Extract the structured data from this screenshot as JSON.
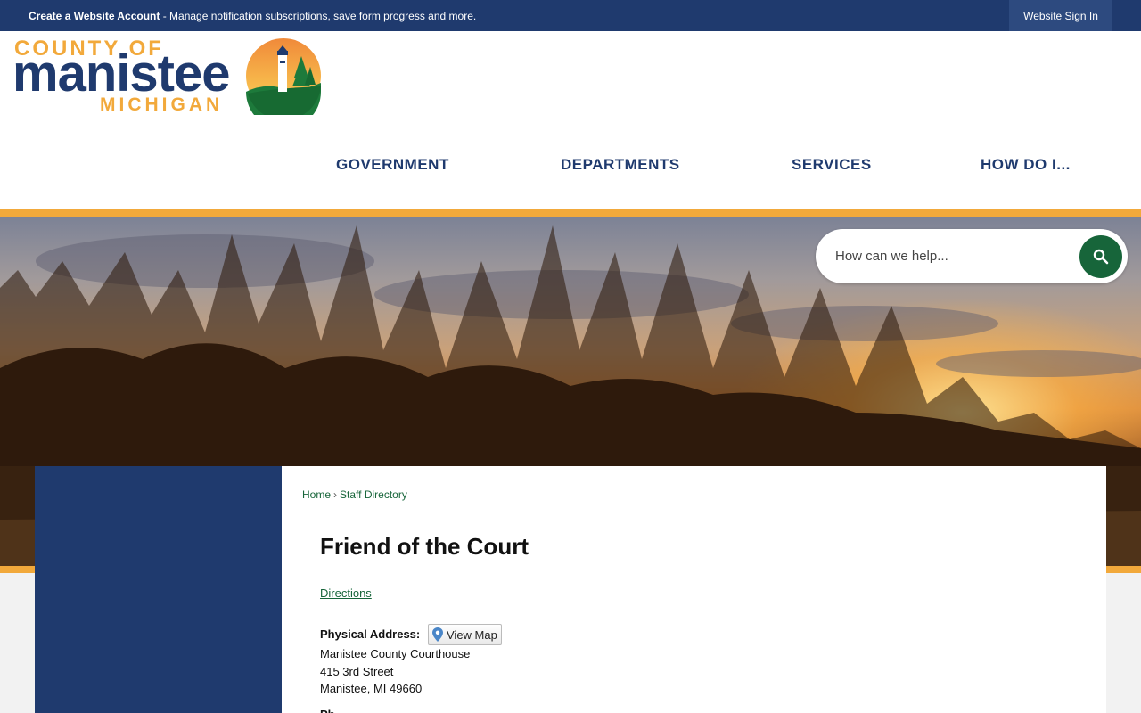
{
  "topbar": {
    "account_bold": "Create a Website Account",
    "account_rest": " - Manage notification subscriptions, save form progress and more.",
    "signin": "Website Sign In"
  },
  "logo": {
    "line1": "COUNTY OF",
    "line2": "manistee",
    "line3": "MICHIGAN"
  },
  "nav": [
    "GOVERNMENT",
    "DEPARTMENTS",
    "SERVICES",
    "HOW DO I..."
  ],
  "search": {
    "placeholder": "How can we help..."
  },
  "breadcrumb": {
    "home": "Home",
    "separator": "›",
    "current": "Staff Directory"
  },
  "page": {
    "title": "Friend of the Court",
    "directions": "Directions",
    "address_label": "Physical Address:",
    "view_map": "View Map",
    "address": [
      "Manistee County Courthouse",
      "415 3rd Street",
      "Manistee, MI 49660"
    ],
    "next_label_partial": "Ph"
  },
  "colors": {
    "navy": "#1f3a6e",
    "orange": "#f2a93b",
    "green": "#17653a"
  }
}
